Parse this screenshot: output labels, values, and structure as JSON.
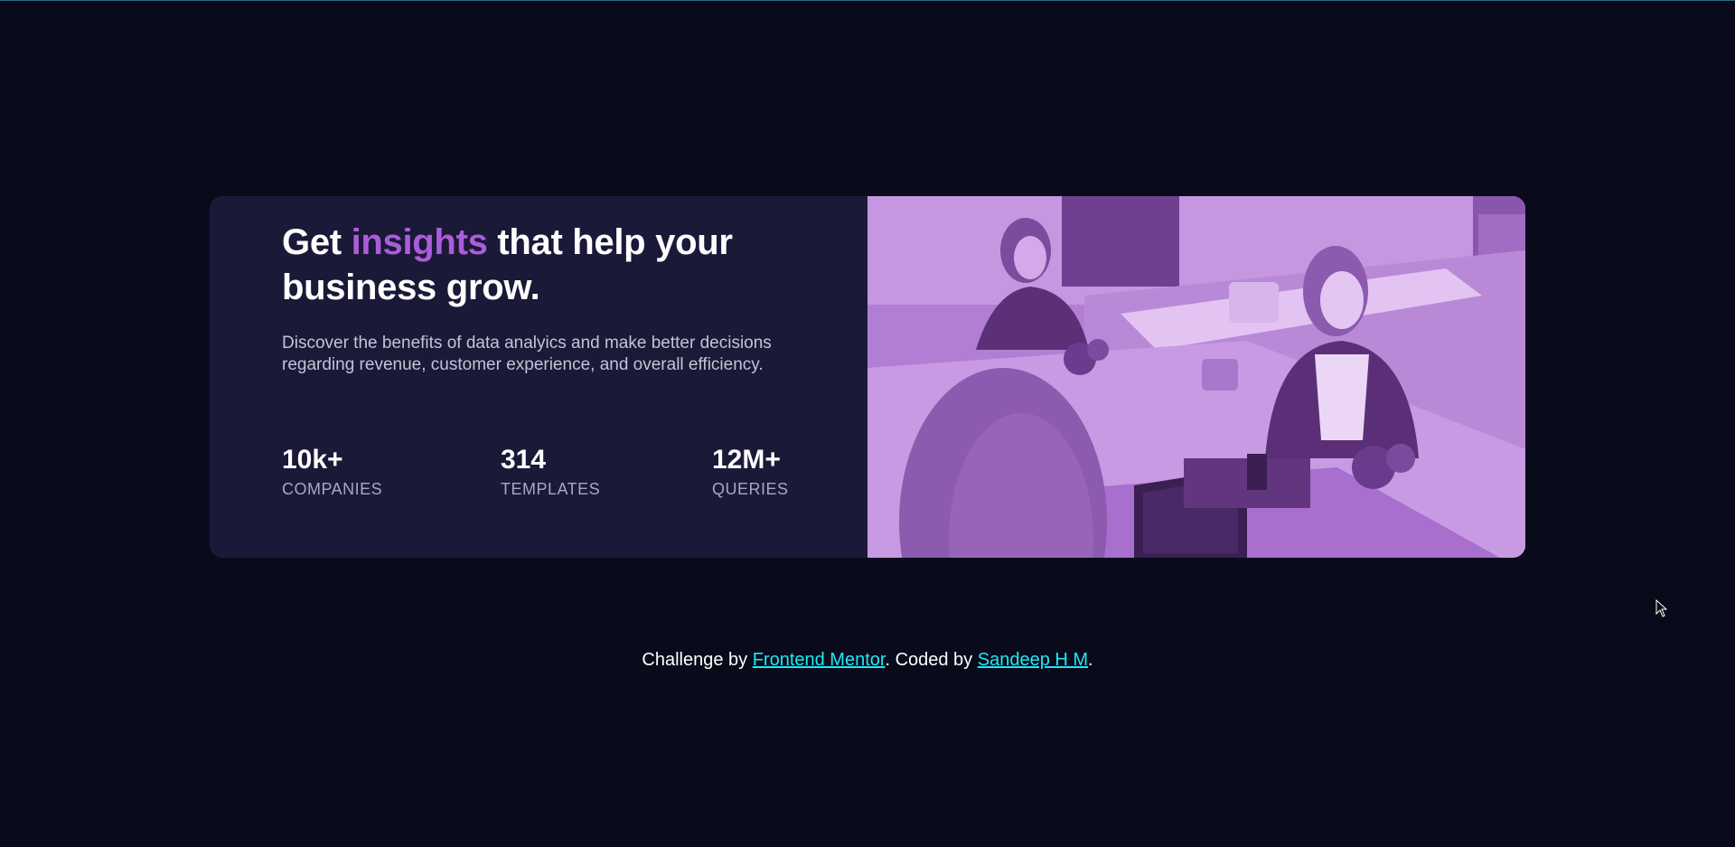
{
  "card": {
    "headline_pre": "Get ",
    "headline_accent": "insights",
    "headline_post": " that help your business grow.",
    "description": "Discover the benefits of data analyics and make better decisions regarding revenue, customer experience, and overall efficiency.",
    "stats": [
      {
        "value": "10k+",
        "label": "COMPANIES"
      },
      {
        "value": "314",
        "label": "TEMPLATES"
      },
      {
        "value": "12M+",
        "label": "QUERIES"
      }
    ],
    "image_icon": "office-photo-icon"
  },
  "footer": {
    "prefix": "Challenge by ",
    "link1": "Frontend Mentor",
    "middle": ". Coded by ",
    "link2": "Sandeep H M",
    "suffix": "."
  },
  "colors": {
    "page_background": "#090b1a",
    "card_background": "#1b1938",
    "accent": "#ab5cdb",
    "link": "#1ee8f5",
    "image_tint": "#b27ed3"
  }
}
